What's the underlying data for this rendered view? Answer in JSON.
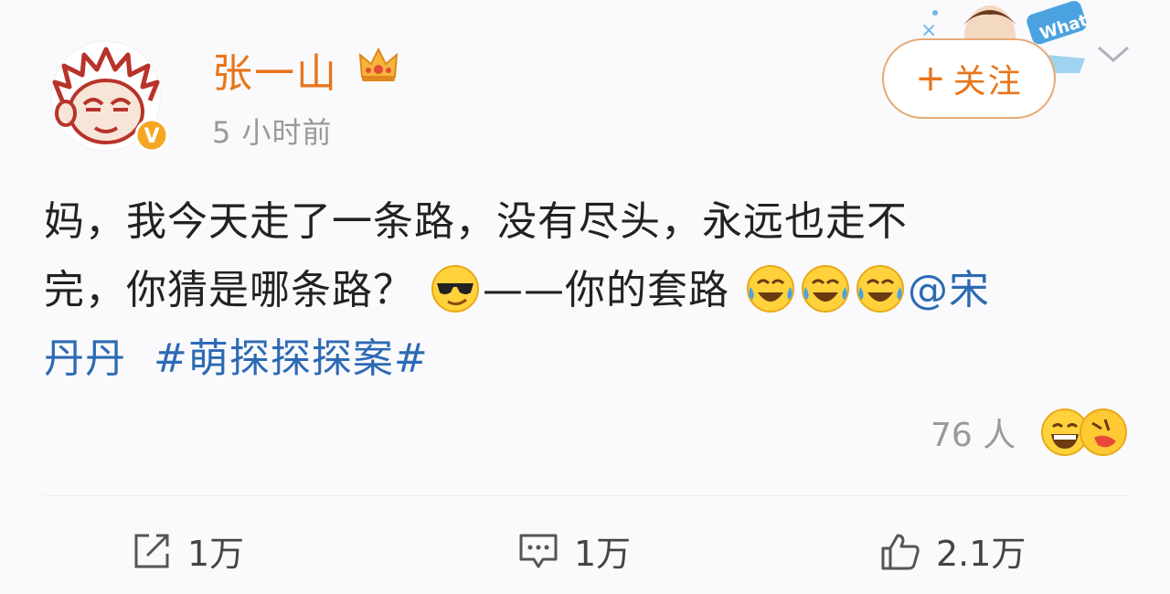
{
  "author": {
    "name": "张一山",
    "time": "5 小时前"
  },
  "follow": {
    "plus": "+",
    "label": "关注"
  },
  "sticker": {
    "text": "What"
  },
  "post": {
    "line1": "妈，我今天走了一条路，没有尽头，永远也走不",
    "line2a": "完，你猜是哪条路？",
    "line2b": "——你的套路",
    "mention": "@宋",
    "mention_cont": "丹丹",
    "hashtag": "#萌探探探案#"
  },
  "reactions": {
    "count": "76 人"
  },
  "actions": {
    "repost": "1万",
    "comment": "1万",
    "like": "2.1万"
  },
  "colors": {
    "username": "#e8751a",
    "link": "#2d6ab3",
    "muted": "#999999"
  }
}
